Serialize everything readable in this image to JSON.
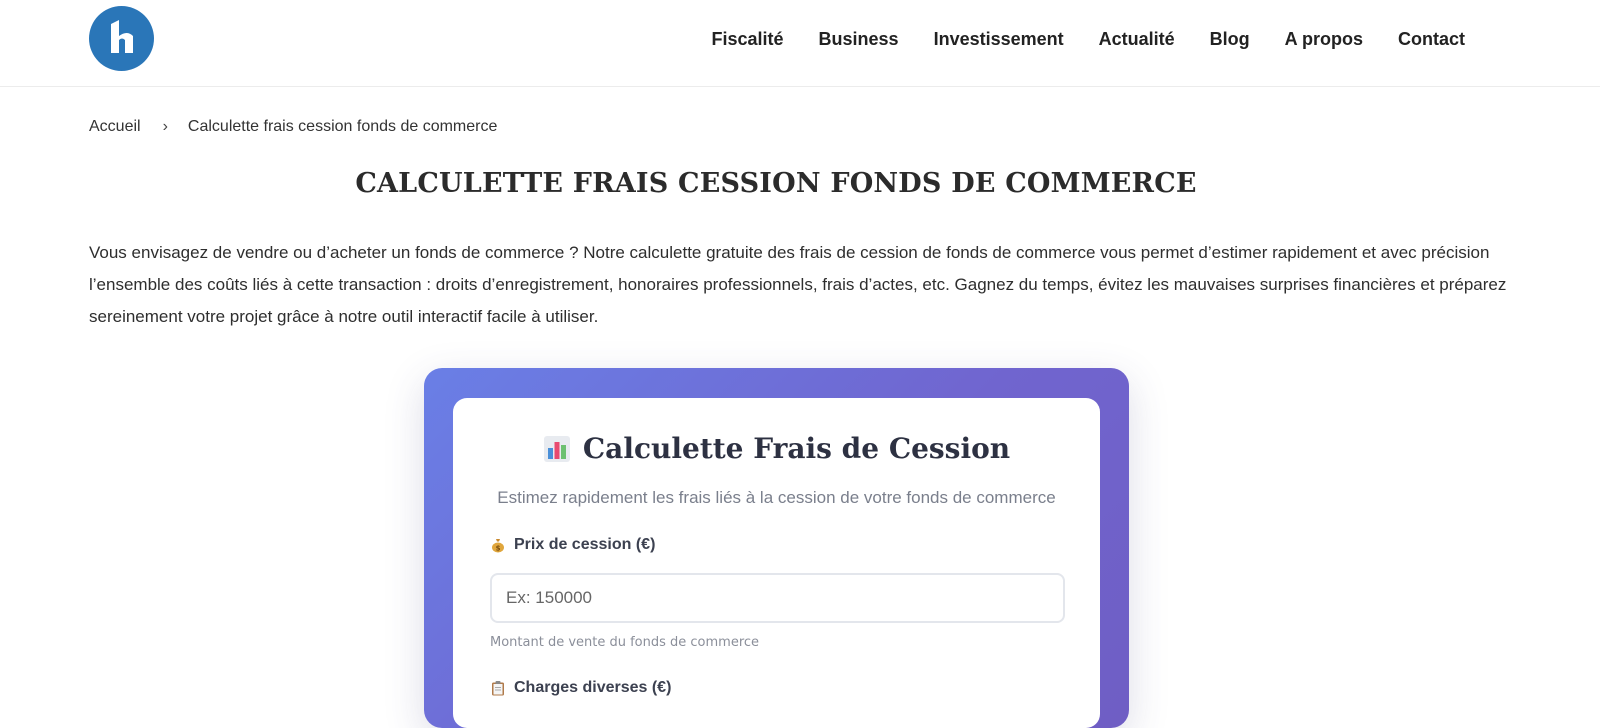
{
  "nav": {
    "items": [
      "Fiscalité",
      "Business",
      "Investissement",
      "Actualité",
      "Blog",
      "A propos",
      "Contact"
    ]
  },
  "breadcrumb": {
    "home": "Accueil",
    "separator": "›",
    "current": "Calculette frais cession fonds de commerce"
  },
  "page": {
    "title": "CALCULETTE FRAIS CESSION FONDS DE COMMERCE",
    "intro": "Vous envisagez de vendre ou d’acheter un fonds de commerce ? Notre calculette gratuite des frais de cession de fonds de commerce vous permet d’estimer rapidement et avec précision l’ensemble des coûts liés à cette transaction : droits d’enregistrement, honoraires professionnels, frais d’actes, etc. Gagnez du temps, évitez les mauvaises surprises financières et préparez sereinement votre projet grâce à notre outil interactif facile à utiliser."
  },
  "calculator": {
    "title": "Calculette Frais de Cession",
    "title_icon": "bar-chart-emoji-icon",
    "subtitle": "Estimez rapidement les frais liés à la cession de votre fonds de commerce",
    "price_field": {
      "icon": "money-bag-emoji-icon",
      "label": "Prix de cession (€)",
      "placeholder": "Ex: 150000",
      "value": "",
      "help": "Montant de vente du fonds de commerce"
    },
    "charges_field": {
      "icon": "clipboard-emoji-icon",
      "label": "Charges diverses (€)"
    }
  },
  "colors": {
    "logo": "#2a76b8",
    "gradient_start": "#6a7fe6",
    "gradient_end": "#6f5ec4"
  }
}
